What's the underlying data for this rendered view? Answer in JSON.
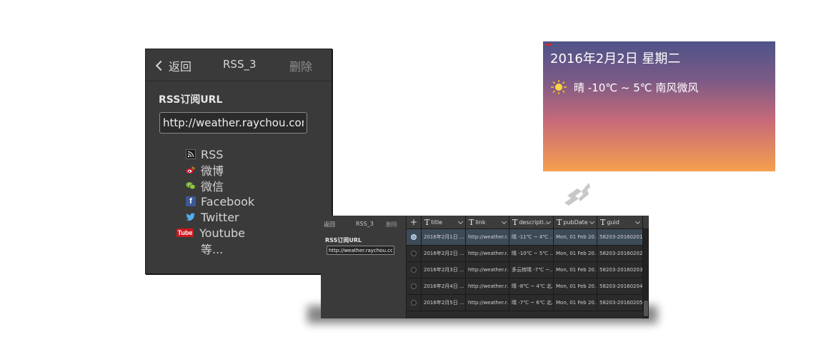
{
  "rss_panel": {
    "back_label": "返回",
    "title": "RSS_3",
    "delete_label": "删除",
    "url_label": "RSS订阅URL",
    "url_value": "http://weather.raychou.com",
    "sources": [
      {
        "label": "RSS",
        "icon": "rss-icon"
      },
      {
        "label": "微博",
        "icon": "weibo-icon"
      },
      {
        "label": "微信",
        "icon": "wechat-icon"
      },
      {
        "label": "Facebook",
        "icon": "facebook-icon"
      },
      {
        "label": "Twitter",
        "icon": "twitter-icon"
      },
      {
        "label": "Youtube",
        "icon": "youtube-icon"
      }
    ],
    "more_label": "等...",
    "youtube_logo_text": "Tube",
    "facebook_logo_text": "f"
  },
  "weather": {
    "date": "2016年2月2日 星期二",
    "condition": "晴 -10℃ ~ 5℃ 南风微风",
    "icon": "sun-icon"
  },
  "small_panel": {
    "back_label": "返回",
    "title": "RSS_3",
    "delete_label": "删除",
    "url_label": "RSS订阅URL",
    "url_value": "http://weather.raychou.com"
  },
  "grid": {
    "add_symbol": "+",
    "type_symbol": "T",
    "columns": [
      "title",
      "link",
      "descripti...",
      "pubDate",
      "guid"
    ],
    "rows": [
      [
        "2016年2月1日 ...",
        "http://weather.r...",
        "晴 -11℃ ~ 4℃ ...",
        "Mon, 01 Feb 20...",
        "58203-20160201"
      ],
      [
        "2016年2月2日 ...",
        "http://weather.r...",
        "晴 -10℃ ~ 5℃ ...",
        "Mon, 01 Feb 20...",
        "58203-20160202"
      ],
      [
        "2016年2月3日 ...",
        "http://weather.r...",
        "多云转晴 -7℃ ~...",
        "Mon, 01 Feb 20...",
        "58203-20160203"
      ],
      [
        "2016年2月4日 ...",
        "http://weather.r...",
        "晴 -8℃ ~ 4℃ 北...",
        "Mon, 01 Feb 20...",
        "58203-20160204"
      ],
      [
        "2016年2月5日 ...",
        "http://weather.r...",
        "晴 -7℃ ~ 6℃ 北...",
        "Mon, 01 Feb 20...",
        "58203-20160205"
      ]
    ],
    "selected_row": 0
  },
  "colors": {
    "panel_bg": "#3a3a3a",
    "selected_row": "#3d4b57",
    "weather_top": "#4e5388",
    "weather_bottom": "#f5a04e"
  }
}
